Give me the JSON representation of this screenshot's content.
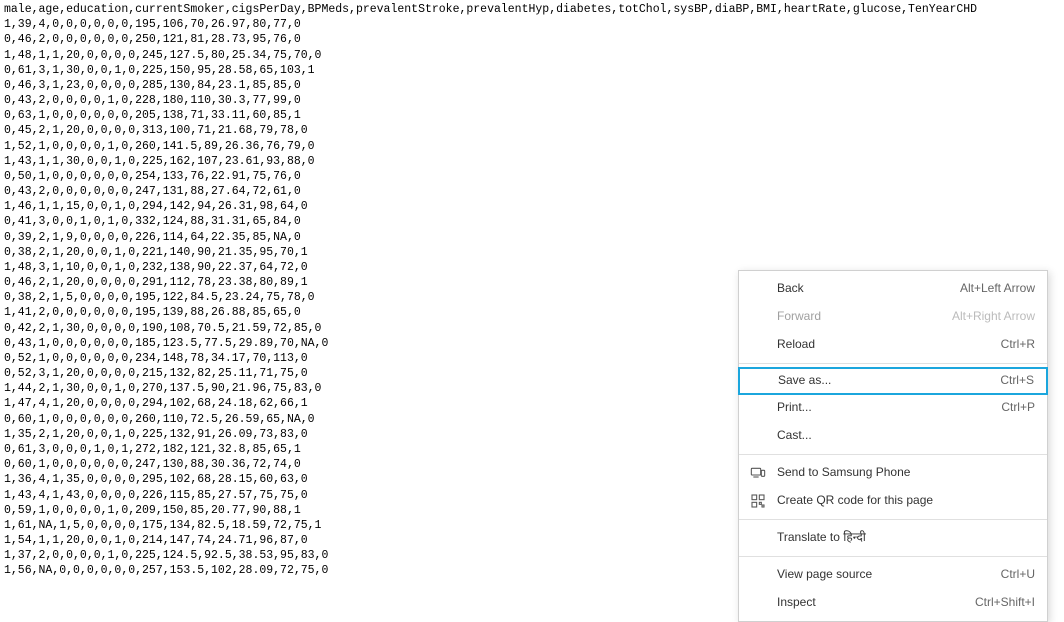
{
  "csv": {
    "header": "male,age,education,currentSmoker,cigsPerDay,BPMeds,prevalentStroke,prevalentHyp,diabetes,totChol,sysBP,diaBP,BMI,heartRate,glucose,TenYearCHD",
    "rows": [
      "1,39,4,0,0,0,0,0,0,195,106,70,26.97,80,77,0",
      "0,46,2,0,0,0,0,0,0,250,121,81,28.73,95,76,0",
      "1,48,1,1,20,0,0,0,0,245,127.5,80,25.34,75,70,0",
      "0,61,3,1,30,0,0,1,0,225,150,95,28.58,65,103,1",
      "0,46,3,1,23,0,0,0,0,285,130,84,23.1,85,85,0",
      "0,43,2,0,0,0,0,1,0,228,180,110,30.3,77,99,0",
      "0,63,1,0,0,0,0,0,0,205,138,71,33.11,60,85,1",
      "0,45,2,1,20,0,0,0,0,313,100,71,21.68,79,78,0",
      "1,52,1,0,0,0,0,1,0,260,141.5,89,26.36,76,79,0",
      "1,43,1,1,30,0,0,1,0,225,162,107,23.61,93,88,0",
      "0,50,1,0,0,0,0,0,0,254,133,76,22.91,75,76,0",
      "0,43,2,0,0,0,0,0,0,247,131,88,27.64,72,61,0",
      "1,46,1,1,15,0,0,1,0,294,142,94,26.31,98,64,0",
      "0,41,3,0,0,1,0,1,0,332,124,88,31.31,65,84,0",
      "0,39,2,1,9,0,0,0,0,226,114,64,22.35,85,NA,0",
      "0,38,2,1,20,0,0,1,0,221,140,90,21.35,95,70,1",
      "1,48,3,1,10,0,0,1,0,232,138,90,22.37,64,72,0",
      "0,46,2,1,20,0,0,0,0,291,112,78,23.38,80,89,1",
      "0,38,2,1,5,0,0,0,0,195,122,84.5,23.24,75,78,0",
      "1,41,2,0,0,0,0,0,0,195,139,88,26.88,85,65,0",
      "0,42,2,1,30,0,0,0,0,190,108,70.5,21.59,72,85,0",
      "0,43,1,0,0,0,0,0,0,185,123.5,77.5,29.89,70,NA,0",
      "0,52,1,0,0,0,0,0,0,234,148,78,34.17,70,113,0",
      "0,52,3,1,20,0,0,0,0,215,132,82,25.11,71,75,0",
      "1,44,2,1,30,0,0,1,0,270,137.5,90,21.96,75,83,0",
      "1,47,4,1,20,0,0,0,0,294,102,68,24.18,62,66,1",
      "0,60,1,0,0,0,0,0,0,260,110,72.5,26.59,65,NA,0",
      "1,35,2,1,20,0,0,1,0,225,132,91,26.09,73,83,0",
      "0,61,3,0,0,0,1,0,1,272,182,121,32.8,85,65,1",
      "0,60,1,0,0,0,0,0,0,247,130,88,30.36,72,74,0",
      "1,36,4,1,35,0,0,0,0,295,102,68,28.15,60,63,0",
      "1,43,4,1,43,0,0,0,0,226,115,85,27.57,75,75,0",
      "0,59,1,0,0,0,0,1,0,209,150,85,20.77,90,88,1",
      "1,61,NA,1,5,0,0,0,0,175,134,82.5,18.59,72,75,1",
      "1,54,1,1,20,0,0,1,0,214,147,74,24.71,96,87,0",
      "1,37,2,0,0,0,0,1,0,225,124.5,92.5,38.53,95,83,0",
      "1,56,NA,0,0,0,0,0,0,257,153.5,102,28.09,72,75,0"
    ]
  },
  "contextMenu": {
    "back": {
      "label": "Back",
      "shortcut": "Alt+Left Arrow"
    },
    "forward": {
      "label": "Forward",
      "shortcut": "Alt+Right Arrow"
    },
    "reload": {
      "label": "Reload",
      "shortcut": "Ctrl+R"
    },
    "saveAs": {
      "label": "Save as...",
      "shortcut": "Ctrl+S"
    },
    "print": {
      "label": "Print...",
      "shortcut": "Ctrl+P"
    },
    "cast": {
      "label": "Cast..."
    },
    "sendToPhone": {
      "label": "Send to Samsung Phone"
    },
    "createQR": {
      "label": "Create QR code for this page"
    },
    "translate": {
      "label": "Translate to हिन्दी"
    },
    "viewSource": {
      "label": "View page source",
      "shortcut": "Ctrl+U"
    },
    "inspect": {
      "label": "Inspect",
      "shortcut": "Ctrl+Shift+I"
    }
  }
}
